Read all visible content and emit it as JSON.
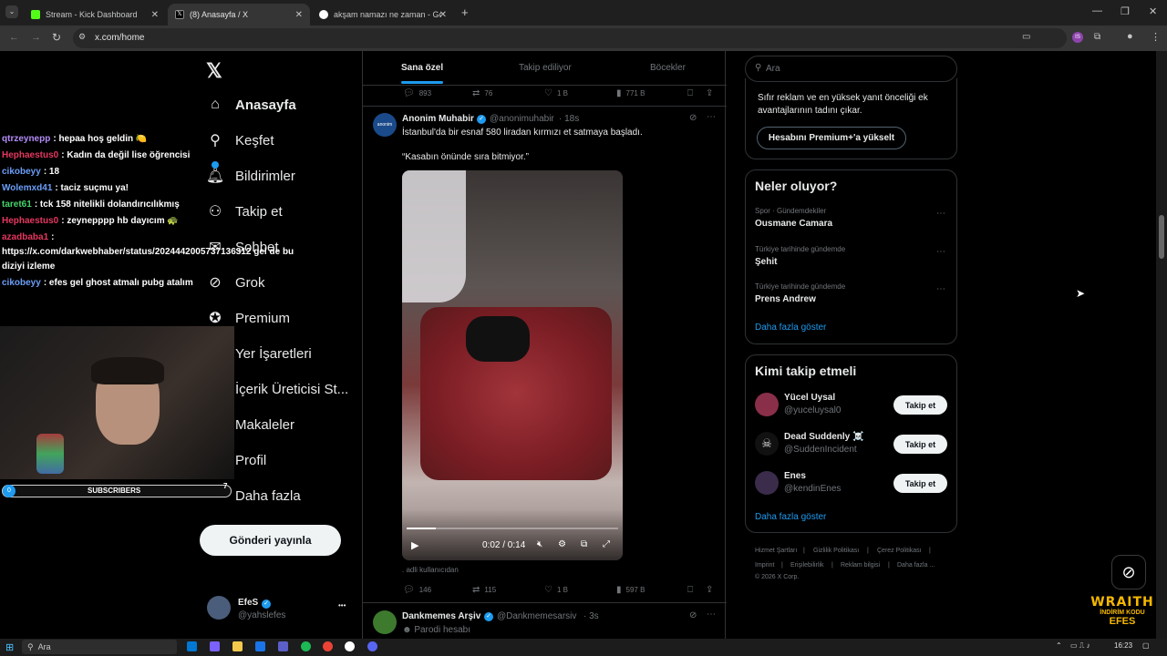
{
  "browser": {
    "tabs": [
      {
        "title": "Stream - Kick Dashboard",
        "active": false
      },
      {
        "title": "(8) Anasayfa / X",
        "active": true
      },
      {
        "title": "akşam namazı ne zaman - Goo",
        "active": false
      }
    ],
    "new_tab": "+",
    "url": "x.com/home"
  },
  "nav": {
    "items": [
      {
        "label": "Anasayfa",
        "icon": "home-icon"
      },
      {
        "label": "Keşfet",
        "icon": "search-icon"
      },
      {
        "label": "Bildirimler",
        "icon": "bell-icon"
      },
      {
        "label": "Takip et",
        "icon": "person-plus-icon"
      },
      {
        "label": "Sohbet",
        "icon": "mail-icon"
      },
      {
        "label": "Grok",
        "icon": "grok-icon"
      },
      {
        "label": "Premium",
        "icon": "verified-icon"
      },
      {
        "label": "Yer İşaretleri",
        "icon": "bookmark-icon"
      },
      {
        "label": "İçerik Üreticisi St...",
        "icon": "lightning-icon"
      },
      {
        "label": "Makaleler",
        "icon": "article-icon"
      },
      {
        "label": "Profil",
        "icon": "person-icon"
      },
      {
        "label": "Daha fazla",
        "icon": "more-icon"
      }
    ],
    "post_button": "Gönderi yayınla",
    "account": {
      "name": "EfeS",
      "handle": "@yahslefes",
      "more": "•••"
    }
  },
  "feed": {
    "tabs": [
      "Sana özel",
      "Takip ediliyor",
      "Böcekler"
    ],
    "prev_actions": {
      "replies": "893",
      "reposts": "76",
      "likes": "1 B",
      "views": "771 B"
    },
    "tweet": {
      "author": "Anonim Muhabir",
      "handle": "@anonimuhabir",
      "time": "· 18s",
      "text1": "İstanbul'da bir esnaf 580 liradan kırmızı et satmaya başladı.",
      "text2": "“Kasabın önünde sıra bitmiyor.”",
      "video_time": "0:02 / 0:14",
      "caption": ". adli kullanıcıdan",
      "actions": {
        "replies": "146",
        "reposts": "115",
        "likes": "1 B",
        "views": "597 B"
      }
    },
    "next_tweet": {
      "author": "Dankmemes Arşiv",
      "handle": "@Dankmemesarsiv",
      "time": "· 3s",
      "subtitle": "Parodi hesabı"
    }
  },
  "sidebar": {
    "search_placeholder": "Ara",
    "premium": {
      "text": "Sıfır reklam ve en yüksek yanıt önceliği ek avantajlarının tadını çıkar.",
      "button": "Hesabını Premium+'a yükselt"
    },
    "trends": {
      "title": "Neler oluyor?",
      "items": [
        {
          "meta": "Spor · Gündemdekiler",
          "name": "Ousmane Camara"
        },
        {
          "meta": "Türkiye tarihinde gündemde",
          "name": "Şehit"
        },
        {
          "meta": "Türkiye tarihinde gündemde",
          "name": "Prens Andrew"
        }
      ],
      "show_more": "Daha fazla göster"
    },
    "who_to_follow": {
      "title": "Kimi takip etmeli",
      "items": [
        {
          "name": "Yücel Uysal",
          "handle": "@yuceluysal0",
          "button": "Takip et"
        },
        {
          "name": "Dead Suddenly ☠️",
          "handle": "@SuddenIncident",
          "button": "Takip et"
        },
        {
          "name": "Enes",
          "handle": "@kendinEnes",
          "button": "Takip et"
        }
      ],
      "show_more": "Daha fazla göster"
    },
    "footer": [
      "Hizmet Şartları",
      "|",
      "Gizlilik Politikası",
      "|",
      "Çerez Politikası",
      "|",
      "Imprint",
      "|",
      "Erişilebilirlik",
      "|",
      "Reklam bilgisi",
      "|",
      "Daha fazla ...",
      "© 2026 X Corp."
    ]
  },
  "stream_overlay": {
    "chat": [
      {
        "user": "qtrzeynepp",
        "color": "#b38cf7",
        "msg": ": hepaa hoş geldin 🍋"
      },
      {
        "user": "Hephaestus0",
        "color": "#e5375f",
        "msg": ": Kadın da değil lise öğrencisi"
      },
      {
        "user": "cikobeyy",
        "color": "#6c9ef8",
        "msg": ": 18"
      },
      {
        "user": "Wolemxd41",
        "color": "#6c9ef8",
        "msg": ": taciz suçmu ya!"
      },
      {
        "user": "taret61",
        "color": "#47d36a",
        "msg": ": tck 158 nitelikli dolandırıcılıkmış"
      },
      {
        "user": "Hephaestus0",
        "color": "#e5375f",
        "msg": ": zeynepppp hb dayıcım 🐢"
      },
      {
        "user": "azadbaba1",
        "color": "#e5375f",
        "msg": ":"
      },
      {
        "user": "",
        "color": "#ffffff",
        "msg": "https://x.com/darkwebhaber/status/2024442005737136312 gel de bu"
      },
      {
        "user": "",
        "color": "#ffffff",
        "msg": "diziyi izleme"
      },
      {
        "user": "cikobeyy",
        "color": "#6c9ef8",
        "msg": ": efes gel ghost atmalı pubg atalım"
      }
    ],
    "subscribers_label": "SUBSCRIBERS",
    "subscribers_count": "0",
    "sub_badge": "7",
    "brand_line1": "WRAITH",
    "brand_line2": "İNDİRİM KODU",
    "brand_line3": "EFES"
  },
  "taskbar": {
    "search": "Ara",
    "time": "16:23"
  }
}
